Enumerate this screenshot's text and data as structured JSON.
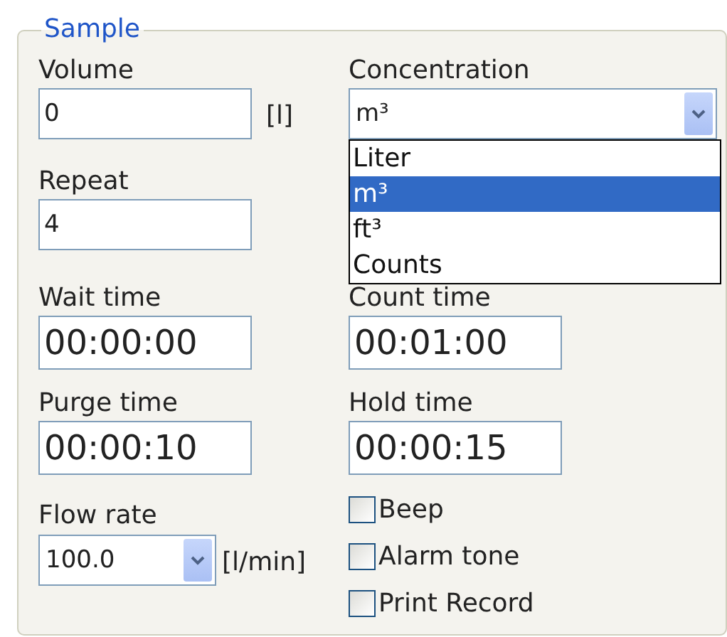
{
  "group": {
    "title": "Sample"
  },
  "volume": {
    "label": "Volume",
    "value": "0",
    "unit": "[l]"
  },
  "concentration": {
    "label": "Concentration",
    "value": "m³",
    "expanded": true,
    "options": [
      {
        "label": "Liter",
        "selected": false
      },
      {
        "label": "m³",
        "selected": true
      },
      {
        "label": "ft³",
        "selected": false
      },
      {
        "label": "Counts",
        "selected": false
      }
    ]
  },
  "repeat": {
    "label": "Repeat",
    "value": "4"
  },
  "wait_time": {
    "label": "Wait time",
    "value": "00:00:00"
  },
  "count_time": {
    "label": "Count time",
    "value": "00:01:00"
  },
  "purge_time": {
    "label": "Purge time",
    "value": "00:00:10"
  },
  "hold_time": {
    "label": "Hold time",
    "value": "00:00:15"
  },
  "flow_rate": {
    "label": "Flow rate",
    "value": "100.0",
    "unit": "[l/min]"
  },
  "checkboxes": [
    {
      "label": "Beep",
      "checked": false
    },
    {
      "label": "Alarm tone",
      "checked": false
    },
    {
      "label": "Print Record",
      "checked": false
    }
  ]
}
